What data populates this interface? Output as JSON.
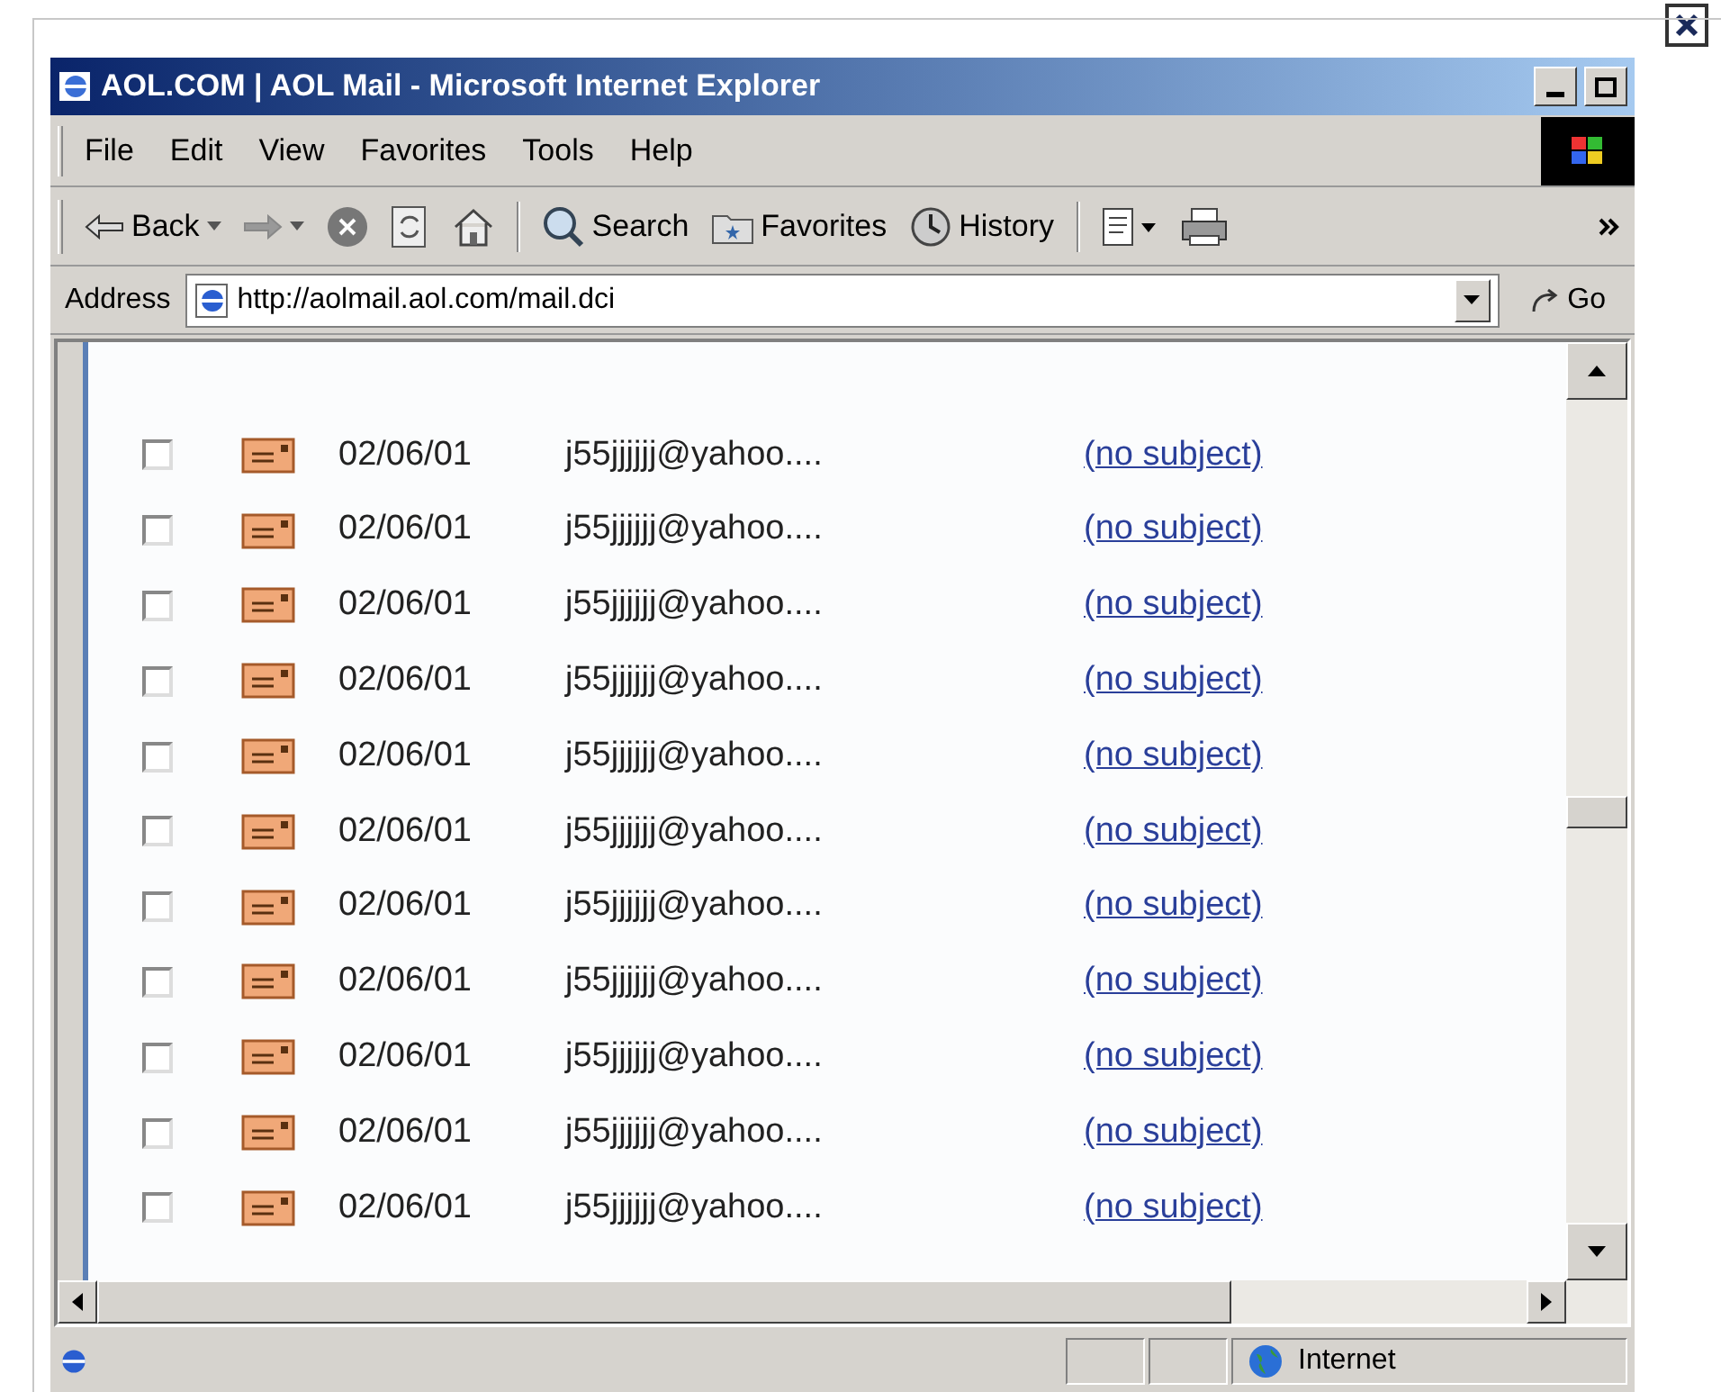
{
  "window": {
    "title": "AOL.COM | AOL Mail - Microsoft Internet Explorer"
  },
  "menu": [
    "File",
    "Edit",
    "View",
    "Favorites",
    "Tools",
    "Help"
  ],
  "toolbar": [
    {
      "kind": "back",
      "label": "Back"
    },
    {
      "kind": "forward"
    },
    {
      "kind": "stop"
    },
    {
      "kind": "refresh"
    },
    {
      "kind": "home"
    },
    {
      "kind": "search",
      "label": "Search"
    },
    {
      "kind": "favorites",
      "label": "Favorites"
    },
    {
      "kind": "history",
      "label": "History"
    },
    {
      "kind": "edit"
    },
    {
      "kind": "print"
    }
  ],
  "address": {
    "label": "Address",
    "url": "http://aolmail.aol.com/mail.dci",
    "go": "Go"
  },
  "messages": [
    {
      "checked": false,
      "date": "02/06/01",
      "from": "j55jjjjjj@yahoo....",
      "subject": "(no subject)"
    },
    {
      "checked": false,
      "date": "02/06/01",
      "from": "j55jjjjjj@yahoo....",
      "subject": "(no subject)"
    },
    {
      "checked": false,
      "date": "02/06/01",
      "from": "j55jjjjjj@yahoo....",
      "subject": "(no subject)"
    },
    {
      "checked": false,
      "date": "02/06/01",
      "from": "j55jjjjjj@yahoo....",
      "subject": "(no subject)"
    },
    {
      "checked": false,
      "date": "02/06/01",
      "from": "j55jjjjjj@yahoo....",
      "subject": "(no subject)"
    },
    {
      "checked": false,
      "date": "02/06/01",
      "from": "j55jjjjjj@yahoo....",
      "subject": "(no subject)"
    },
    {
      "checked": false,
      "date": "02/06/01",
      "from": "j55jjjjjj@yahoo....",
      "subject": "(no subject)"
    },
    {
      "checked": false,
      "date": "02/06/01",
      "from": "j55jjjjjj@yahoo....",
      "subject": "(no subject)"
    },
    {
      "checked": false,
      "date": "02/06/01",
      "from": "j55jjjjjj@yahoo....",
      "subject": "(no subject)"
    },
    {
      "checked": false,
      "date": "02/06/01",
      "from": "j55jjjjjj@yahoo....",
      "subject": "(no subject)"
    },
    {
      "checked": false,
      "date": "02/06/01",
      "from": "j55jjjjjj@yahoo....",
      "subject": "(no subject)"
    }
  ],
  "status_bar": {
    "zone": "Internet"
  }
}
